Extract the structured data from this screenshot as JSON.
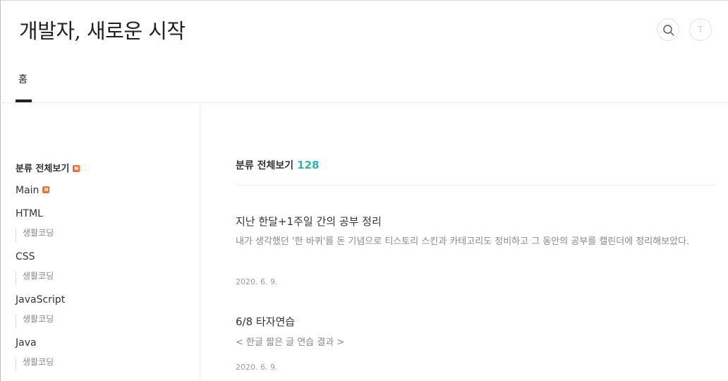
{
  "header": {
    "blog_title": "개발자, 새로운 시작",
    "search_icon": "search-icon",
    "avatar_letter": "T"
  },
  "nav": {
    "tabs": [
      {
        "label": "홈",
        "active": true
      }
    ]
  },
  "sidebar": {
    "category_all": {
      "label": "분류 전체보기",
      "badge": "N"
    },
    "categories": [
      {
        "label": "Main",
        "badge": "N",
        "children": []
      },
      {
        "label": "HTML",
        "children": [
          {
            "label": "생활코딩"
          }
        ]
      },
      {
        "label": "CSS",
        "children": [
          {
            "label": "생활코딩"
          }
        ]
      },
      {
        "label": "JavaScript",
        "children": [
          {
            "label": "생활코딩"
          }
        ]
      },
      {
        "label": "Java",
        "children": [
          {
            "label": "생활코딩"
          }
        ]
      }
    ]
  },
  "content": {
    "heading": "분류 전체보기",
    "count": "128",
    "posts": [
      {
        "title": "지난 한달+1주일 간의 공부 정리",
        "excerpt": "내가 생각했던 '한 바퀴'를 돈 기념으로 티스토리 스킨과 카테고리도 정비하고 그 동안의 공부를 캘린더에 정리해보았다.",
        "date": "2020. 6. 9."
      },
      {
        "title": "6/8 타자연습",
        "excerpt": "< 한글 짧은 글 연습 결과 >",
        "date": "2020. 6. 9."
      }
    ]
  },
  "colors": {
    "accent_count": "#2fb2b0",
    "new_badge": "#e8743b",
    "text_primary": "#333333",
    "text_muted": "#888888"
  }
}
